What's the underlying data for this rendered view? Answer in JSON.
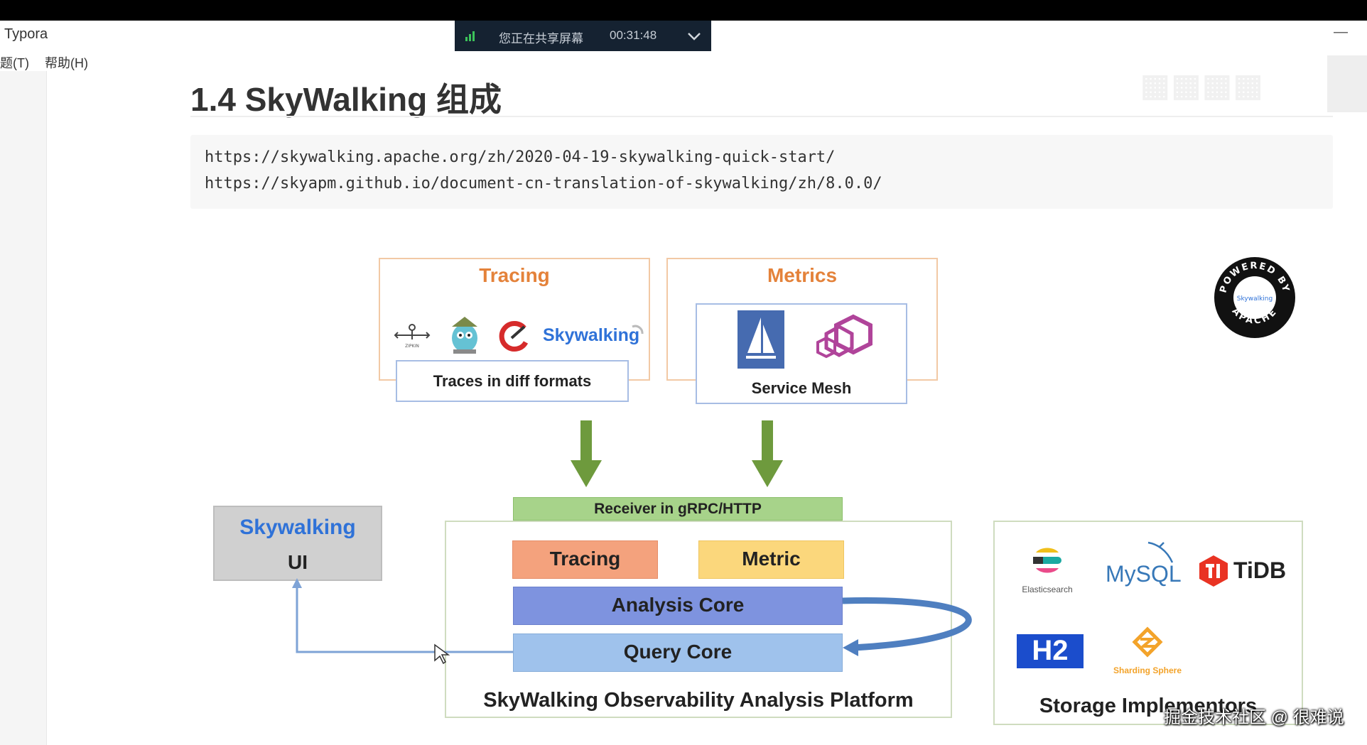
{
  "window": {
    "app_title": "Typora",
    "menu": [
      "题(T)",
      "帮助(H)"
    ],
    "minimize_symbol": "—"
  },
  "share_bar": {
    "message": "您正在共享屏幕",
    "elapsed": "00:31:48"
  },
  "doc": {
    "heading": "1.4 SkyWalking 组成",
    "code_lines": [
      "https://skywalking.apache.org/zh/2020-04-19-skywalking-quick-start/",
      "https://skyapm.github.io/document-cn-translation-of-skywalking/zh/8.0.0/"
    ]
  },
  "diagram": {
    "tracing_title": "Tracing",
    "metrics_title": "Metrics",
    "traces_label": "Traces in diff formats",
    "service_mesh_label": "Service Mesh",
    "skywalking_logo_text": "Skywalking",
    "zipkin_text": "ZIPKIN",
    "receiver_label": "Receiver in gRPC/HTTP",
    "ui_logo": "Skywalking",
    "ui_label": "UI",
    "tracing_core": "Tracing",
    "metric_core": "Metric",
    "analysis_core": "Analysis Core",
    "query_core": "Query Core",
    "platform_label": "SkyWalking Observability Analysis Platform",
    "storage_label": "Storage Implementors",
    "storage": {
      "elasticsearch": "Elasticsearch",
      "mysql": "MySQL",
      "tidb": "TiDB",
      "h2": "H2",
      "sharding": "Sharding Sphere"
    },
    "powered_text": "POWERED BY",
    "apache_text": "APACHE",
    "badge_logo": "Skywalking"
  },
  "footer_watermark": "掘金技术社区 @ 很难说",
  "colors": {
    "orange_title": "#e4823a",
    "green_arrow": "#6e9a3d",
    "receiver_bar": "#a7d38a",
    "tracing_core": "#f4a27d",
    "metric_core": "#fbd77c",
    "analysis_core": "#7e93df",
    "query_core": "#9fc2ec",
    "connector_blue": "#4f7fc0"
  }
}
